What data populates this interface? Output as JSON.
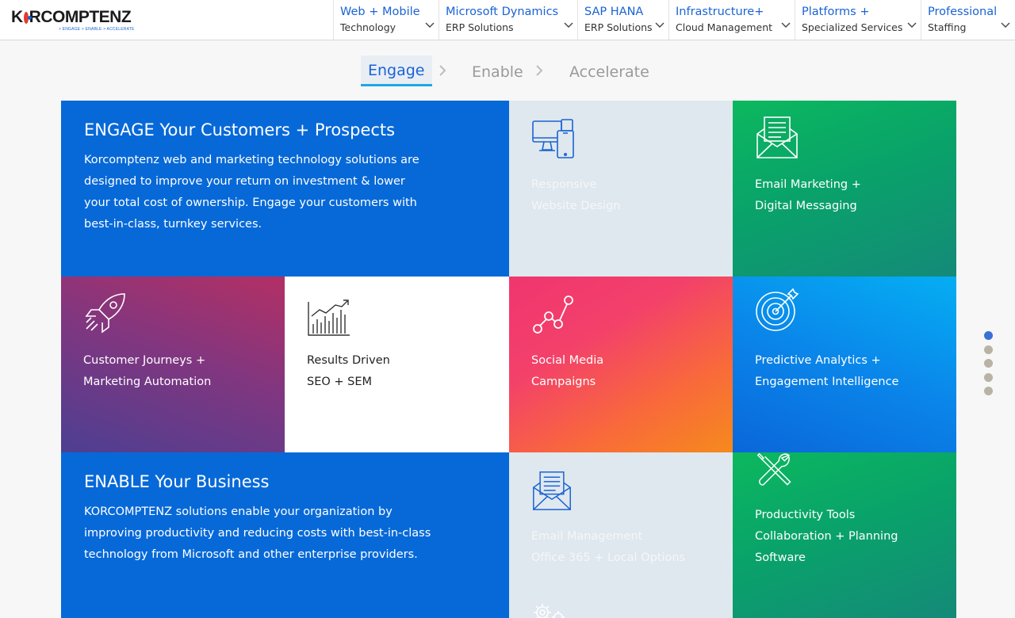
{
  "brand": {
    "logo_text_pre": "K",
    "logo_text_post": "RCOMPTENZ",
    "tagline": "> ENGAGE > ENABLE > ACCELERATE",
    "colors": {
      "primary": "#1a63d4",
      "accent_red": "#e23b2b"
    }
  },
  "nav": [
    {
      "title": "Web + Mobile",
      "sub": "Technology"
    },
    {
      "title": "Microsoft Dynamics",
      "sub": "ERP Solutions"
    },
    {
      "title": "SAP HANA",
      "sub": "ERP Solutions"
    },
    {
      "title": "Infrastructure+",
      "sub": "Cloud Management"
    },
    {
      "title": "Platforms +",
      "sub": "Specialized Services"
    },
    {
      "title": "Professional",
      "sub": "Staffing"
    }
  ],
  "tabs": [
    {
      "label": "Engage",
      "active": true
    },
    {
      "label": "Enable",
      "active": false
    },
    {
      "label": "Accelerate",
      "active": false
    }
  ],
  "engage": {
    "title": "ENGAGE Your Customers + Prospects",
    "description": "Korcomptenz web and marketing technology solutions are designed to improve your return on investment & lower your total cost of ownership. Engage your customers with best-in-class, turnkey services."
  },
  "tiles": {
    "responsive": {
      "line1": "Responsive",
      "line2": "Website Design",
      "icon": "devices-icon"
    },
    "email_marketing": {
      "line1": "Email Marketing +",
      "line2": "Digital Messaging",
      "icon": "envelope-letter-icon"
    },
    "customer_journeys": {
      "line1": "Customer Journeys +",
      "line2": "Marketing Automation",
      "icon": "rocket-icon"
    },
    "results_driven": {
      "line1": "Results Driven",
      "line2": "SEO + SEM",
      "icon": "bar-chart-trend-icon"
    },
    "social_media": {
      "line1": "Social Media",
      "line2": "Campaigns",
      "icon": "connected-nodes-icon"
    },
    "predictive": {
      "line1": "Predictive Analytics +",
      "line2": "Engagement Intelligence",
      "icon": "target-arrow-icon"
    },
    "email_management": {
      "line1": "Email Management",
      "line2": "Office 365 + Local Options",
      "icon": "envelope-letter-icon"
    },
    "productivity": {
      "line1": "Productivity Tools",
      "line2": "Collaboration + Planning",
      "line3": "Software",
      "icon": "wrench-screwdriver-icon"
    }
  },
  "enable": {
    "title": "ENABLE Your Business",
    "description": "KORCOMPTENZ solutions enable your organization by improving productivity and reducing costs with best-in-class technology from Microsoft and other enterprise providers."
  },
  "pager": {
    "count": 5,
    "active_index": 0
  }
}
